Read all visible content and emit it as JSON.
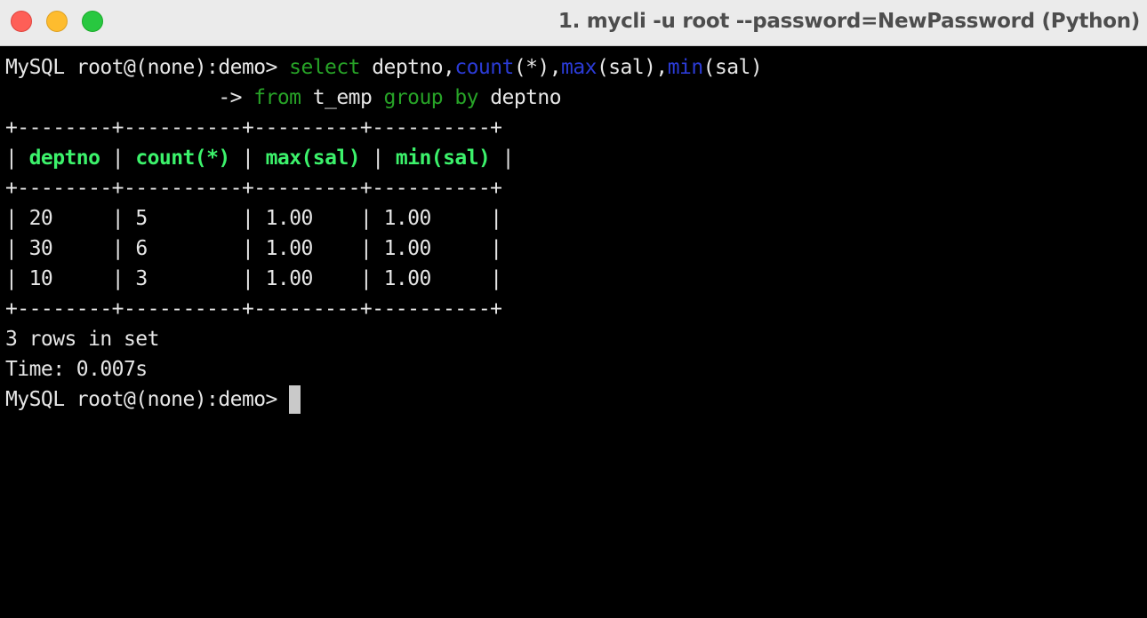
{
  "window": {
    "title": "1. mycli -u root --password=NewPassword (Python)"
  },
  "colors": {
    "keyword": "#27a327",
    "function": "#2b3bd6",
    "header": "#3cf26b",
    "text": "#e6e6e6",
    "background": "#000000"
  },
  "terminal": {
    "prompt": "MySQL root@(none):demo> ",
    "query_line1": {
      "select_kw": "select",
      "after_select": " deptno,",
      "count_fn": "count",
      "count_args": "(*),",
      "max_fn": "max",
      "max_args": "(sal),",
      "min_fn": "min",
      "min_args": "(sal)"
    },
    "query_line2": {
      "continuation": "                  -> ",
      "from_kw": "from",
      "table": " t_emp ",
      "group_kw": "group by",
      "group_col": " deptno"
    },
    "table": {
      "border": "+--------+----------+---------+----------+",
      "columns": [
        "deptno",
        "count(*)",
        "max(sal)",
        "min(sal)"
      ],
      "rows": [
        [
          "20",
          "5",
          "1.00",
          "1.00"
        ],
        [
          "30",
          "6",
          "1.00",
          "1.00"
        ],
        [
          "10",
          "3",
          "1.00",
          "1.00"
        ]
      ]
    },
    "result_summary": "3 rows in set",
    "timing": "Time: 0.007s",
    "final_prompt": "MySQL root@(none):demo> "
  }
}
